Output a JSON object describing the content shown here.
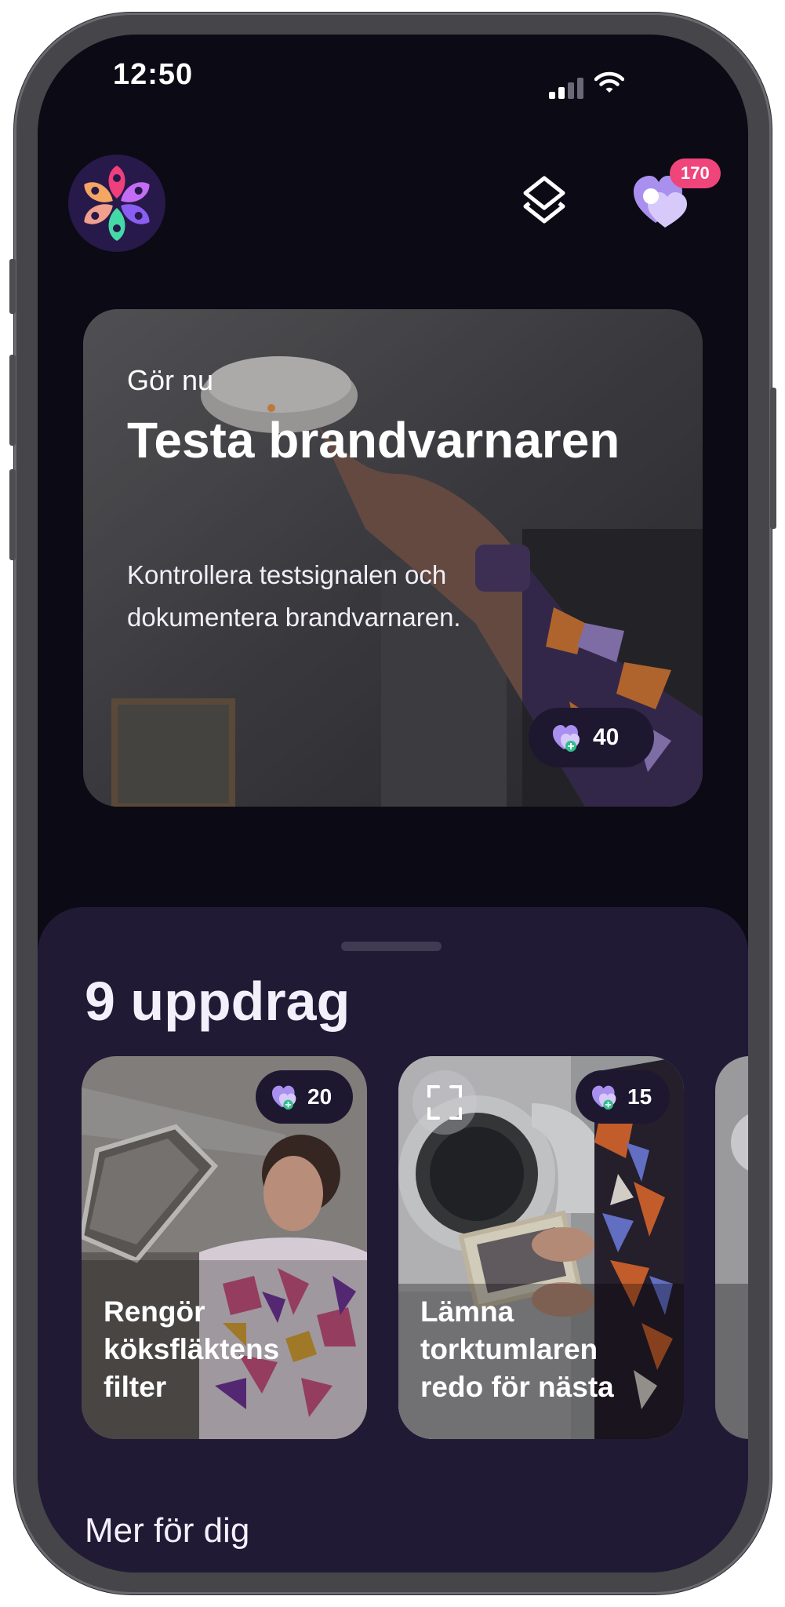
{
  "status": {
    "time": "12:50"
  },
  "header": {
    "logo_icon": "flower-pin-logo",
    "layers_icon": "layers-icon",
    "points_icon": "hearts-icon",
    "points_badge": "170",
    "badge_color": "#f0457a"
  },
  "hero": {
    "eyebrow": "Gör nu",
    "title": "Testa brandvarnaren",
    "description": "Kontrollera testsignalen och dokumentera brandvarnaren.",
    "points": "40"
  },
  "missions": {
    "count_label": "9 uppdrag",
    "cards": [
      {
        "title": "Rengör köksfläktens filter",
        "points": "20"
      },
      {
        "title": "Lämna torktumlaren redo för nästa",
        "points": "15"
      }
    ]
  },
  "more": {
    "title": "Mer för dig"
  },
  "colors": {
    "screen_bg": "#0c0a14",
    "sheet_bg": "#211a35",
    "accent_pink": "#f0457a",
    "accent_purple": "#b59cf6"
  }
}
